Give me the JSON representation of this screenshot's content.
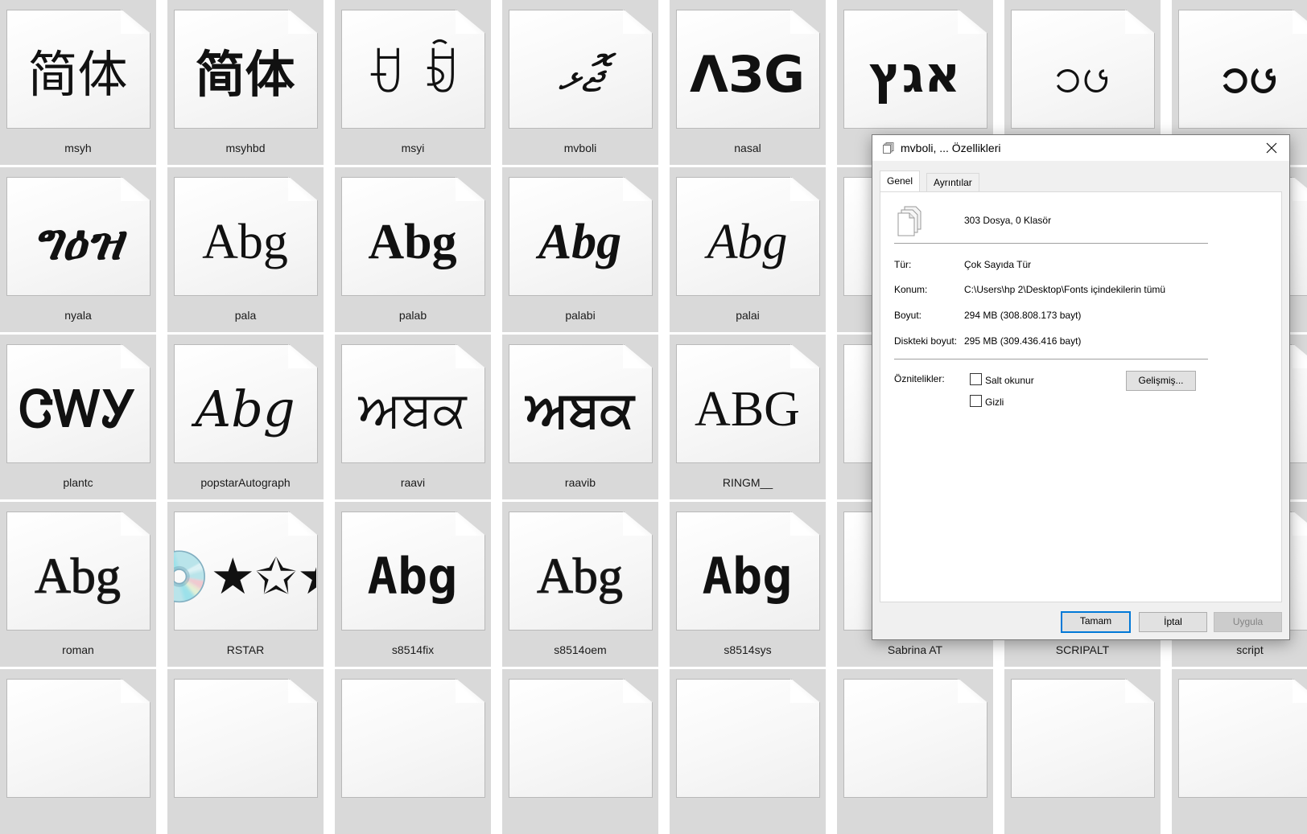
{
  "tiles": [
    {
      "name": "msyh",
      "sample": "简体",
      "style": ""
    },
    {
      "name": "msyhbd",
      "sample": "简体",
      "style": "s-bold"
    },
    {
      "name": "msyi",
      "sample": "ꀀ ꀁ",
      "style": "s-small"
    },
    {
      "name": "mvboli",
      "sample": "ޖޮޅ",
      "style": "s-script"
    },
    {
      "name": "nasal",
      "sample": "ΛЗG",
      "style": "s-bold"
    },
    {
      "name": "",
      "sample": "אגץ",
      "style": "s-bold"
    },
    {
      "name": "",
      "sample": "ၥၒ",
      "style": ""
    },
    {
      "name": "",
      "sample": "ၥၒ",
      "style": "s-bold"
    },
    {
      "name": "nyala",
      "sample": "ግዕዝ",
      "style": "s-bold s-italic"
    },
    {
      "name": "pala",
      "sample": "Abg",
      "style": "s-serif"
    },
    {
      "name": "palab",
      "sample": "Abg",
      "style": "s-serif s-bold"
    },
    {
      "name": "palabi",
      "sample": "Abg",
      "style": "s-serif s-bold s-italic"
    },
    {
      "name": "palai",
      "sample": "Abg",
      "style": "s-serif s-italic"
    },
    {
      "name": "",
      "sample": "",
      "style": ""
    },
    {
      "name": "",
      "sample": "",
      "style": ""
    },
    {
      "name": "",
      "sample": "",
      "style": ""
    },
    {
      "name": "plantc",
      "sample": "ᏣᎳᎩ",
      "style": "s-bold"
    },
    {
      "name": "popstarAutograph",
      "sample": "Abg",
      "style": "s-script"
    },
    {
      "name": "raavi",
      "sample": "ਅਬਕ",
      "style": "s-small"
    },
    {
      "name": "raavib",
      "sample": "ਅਬਕ",
      "style": "s-small s-bold"
    },
    {
      "name": "RINGM__",
      "sample": "ABG",
      "style": "s-serif"
    },
    {
      "name": "",
      "sample": "",
      "style": ""
    },
    {
      "name": "",
      "sample": "",
      "style": ""
    },
    {
      "name": "",
      "sample": "",
      "style": ""
    },
    {
      "name": "roman",
      "sample": "Abg",
      "style": "s-thin"
    },
    {
      "name": "RSTAR",
      "sample": "💿★✩★",
      "style": "s-small"
    },
    {
      "name": "s8514fix",
      "sample": "Abg",
      "style": "s-mono"
    },
    {
      "name": "s8514oem",
      "sample": "Abg",
      "style": "s-thin"
    },
    {
      "name": "s8514sys",
      "sample": "Abg",
      "style": "s-mono"
    },
    {
      "name": "Sabrina AT",
      "sample": "",
      "style": ""
    },
    {
      "name": "SCRIPALT",
      "sample": "",
      "style": ""
    },
    {
      "name": "script",
      "sample": "",
      "style": ""
    },
    {
      "name": "",
      "sample": "",
      "style": ""
    },
    {
      "name": "",
      "sample": "",
      "style": ""
    },
    {
      "name": "",
      "sample": "",
      "style": ""
    },
    {
      "name": "",
      "sample": "",
      "style": ""
    },
    {
      "name": "",
      "sample": "",
      "style": ""
    },
    {
      "name": "",
      "sample": "",
      "style": ""
    },
    {
      "name": "",
      "sample": "",
      "style": ""
    },
    {
      "name": "",
      "sample": "",
      "style": ""
    }
  ],
  "dialog": {
    "title": "mvboli, ... Özellikleri",
    "tabs": {
      "general": "Genel",
      "details": "Ayrıntılar"
    },
    "summary": "303 Dosya, 0 Klasör",
    "type_label": "Tür:",
    "type_value": "Çok Sayıda Tür",
    "location_label": "Konum:",
    "location_value": "C:\\Users\\hp 2\\Desktop\\Fonts içindekilerin tümü",
    "size_label": "Boyut:",
    "size_value": "294 MB (308.808.173 bayt)",
    "disk_size_label": "Diskteki boyut:",
    "disk_size_value": "295 MB (309.436.416 bayt)",
    "attributes_label": "Öznitelikler:",
    "readonly_label": "Salt okunur",
    "hidden_label": "Gizli",
    "advanced_button": "Gelişmiş...",
    "ok_button": "Tamam",
    "cancel_button": "İptal",
    "apply_button": "Uygula"
  }
}
